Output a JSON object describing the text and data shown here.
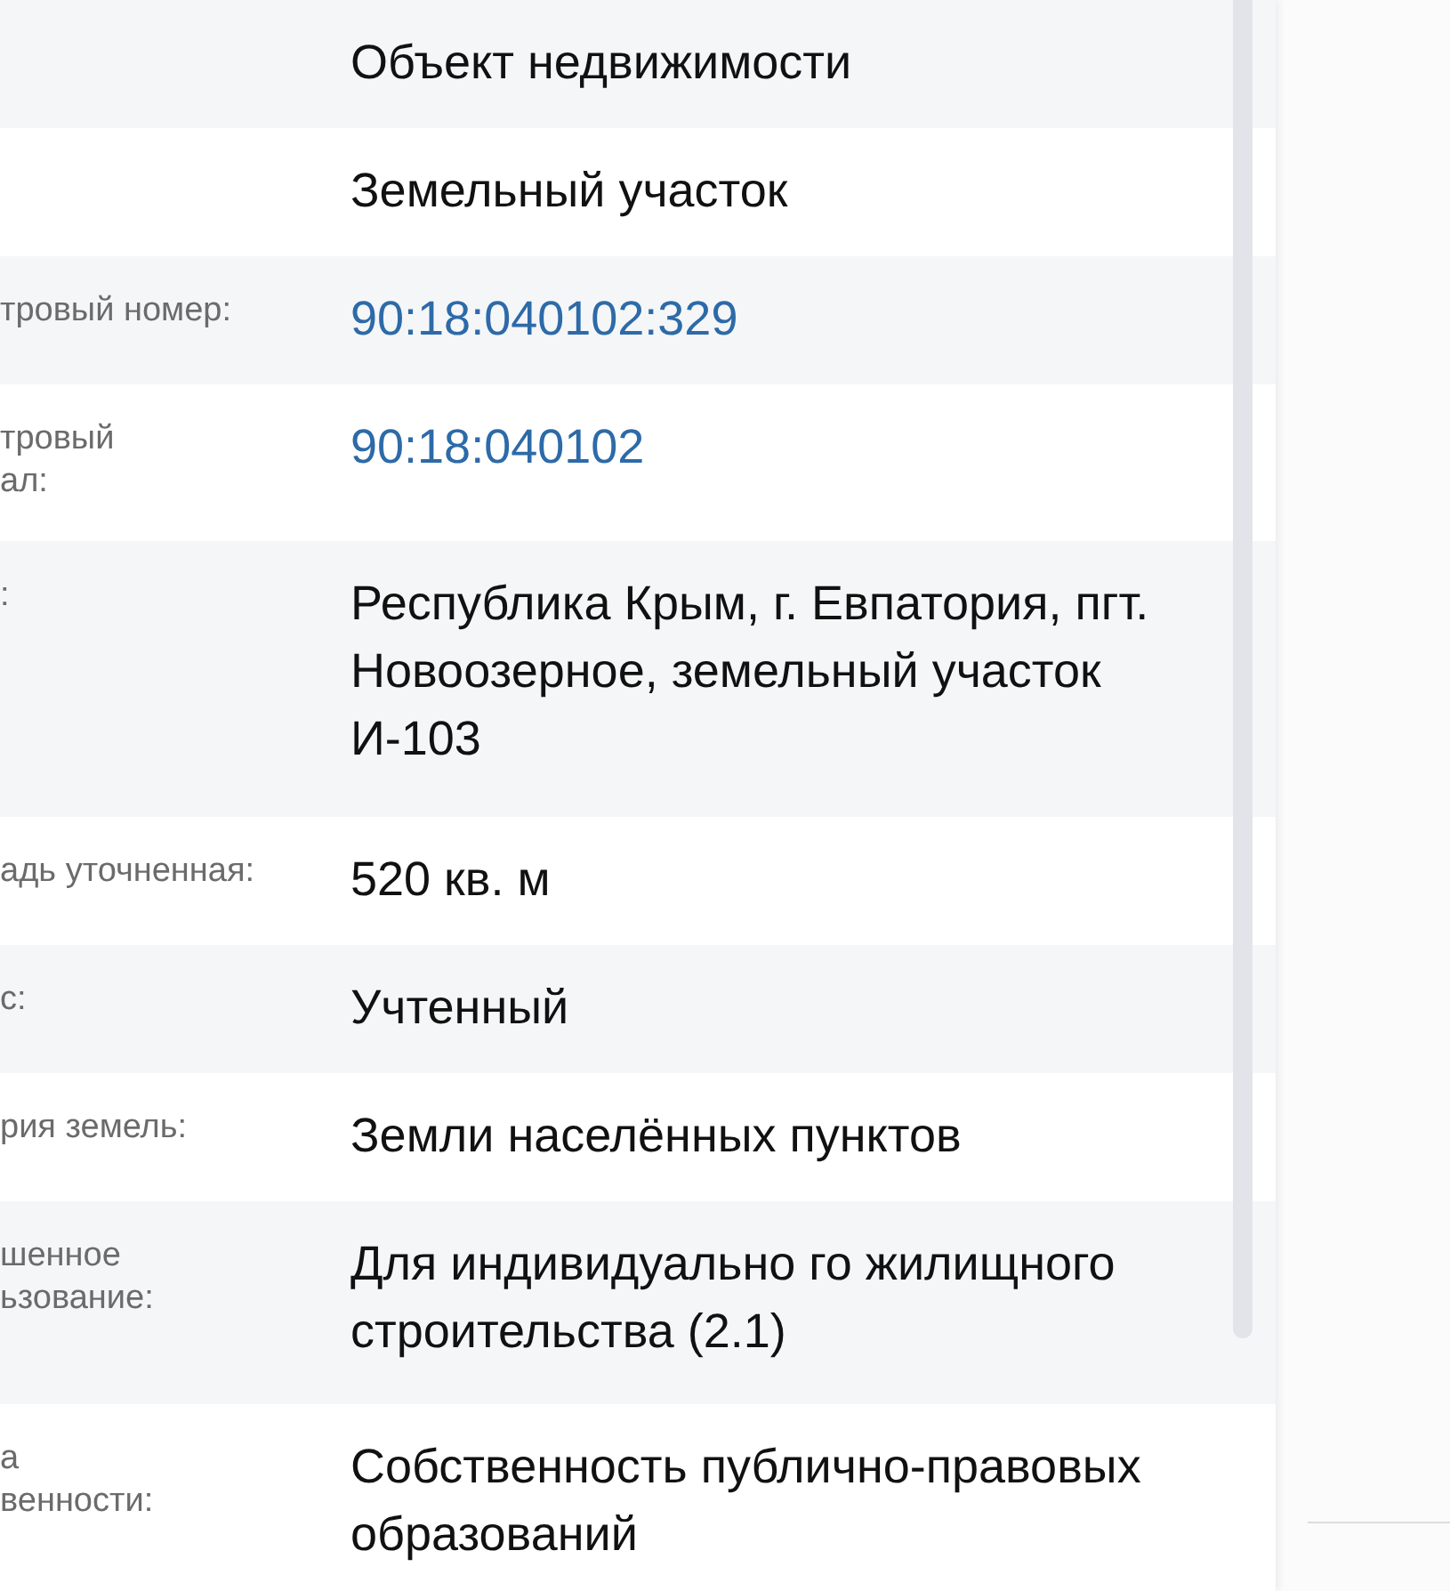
{
  "rows": [
    {
      "label": "",
      "value": "Объект недвижимости",
      "kind": "text"
    },
    {
      "label": "",
      "value": "Земельный участок",
      "kind": "text"
    },
    {
      "label": "тровый номер:",
      "value": "90:18:040102:329",
      "kind": "link"
    },
    {
      "label": "тровый\nал:",
      "value": "90:18:040102",
      "kind": "link"
    },
    {
      "label": ":",
      "value": "Республика Крым, г. Евпатория, пгт. Новоозерное, земельный участок И-103",
      "kind": "text"
    },
    {
      "label": "адь уточненная:",
      "value": "520 кв. м",
      "kind": "text"
    },
    {
      "label": "с:",
      "value": "Учтенный",
      "kind": "text"
    },
    {
      "label": "рия земель:",
      "value": "Земли населённых пунктов",
      "kind": "text"
    },
    {
      "label": "шенное\nьзование:",
      "value": "Для индивидуально го жилищного строительства (2.1)",
      "kind": "text"
    },
    {
      "label": "а\nвенности:",
      "value": "Собственность публично-правовых образований",
      "kind": "text"
    }
  ]
}
